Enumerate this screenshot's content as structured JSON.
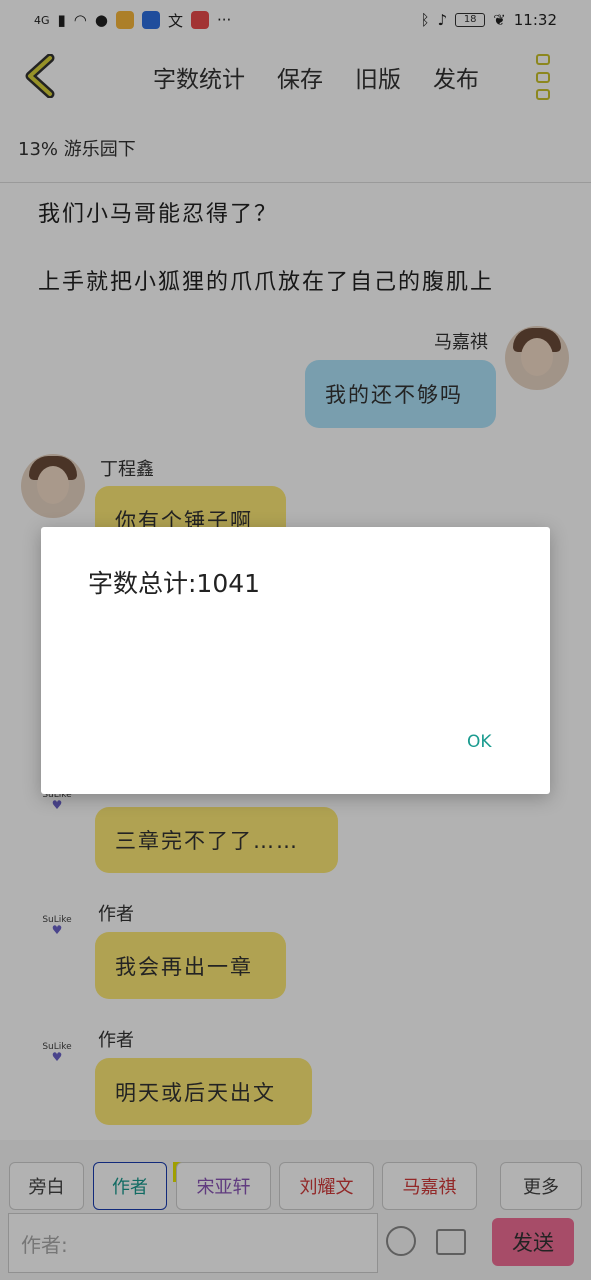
{
  "status_bar": {
    "network": "4G",
    "battery": "18",
    "time": "11:32",
    "icons": [
      "signal-icon",
      "wifi-icon",
      "browser-icon",
      "app-icon",
      "app-icon",
      "translate-icon",
      "app-icon",
      "more-icon",
      "bluetooth-icon",
      "mute-icon",
      "battery-icon",
      "leaf-icon"
    ]
  },
  "toolbar": {
    "word_count_label": "字数统计",
    "save_label": "保存",
    "old_version_label": "旧版",
    "publish_label": "发布"
  },
  "story_header": {
    "progress": "13% 游乐园下"
  },
  "content": {
    "line1": "我们小马哥能忍得了？",
    "line2": "上手就把小狐狸的爪爪放在了自己的腹肌上",
    "msg1_speaker": "马嘉祺",
    "msg1_text": "我的还不够吗",
    "msg2_speaker": "丁程鑫",
    "msg2_text": "你有个锤子啊",
    "msg3_text": "三章完不了了……",
    "msg4_speaker": "作者",
    "msg4_text": "我会再出一章",
    "msg5_speaker": "作者",
    "msg5_text": "明天或后天出文",
    "author_logo": "SuLike"
  },
  "roles": {
    "narration": "旁白",
    "author": "作者",
    "main_tag": "主",
    "song": "宋亚轩",
    "liu": "刘耀文",
    "ma": "马嘉祺",
    "more": "更多"
  },
  "input": {
    "placeholder": "作者:",
    "send_label": "发送"
  },
  "dialog": {
    "message": "字数总计:1041",
    "ok_label": "OK"
  },
  "colors": {
    "blue_bubble": "#aee3fa",
    "yellow_bubble": "#fde876",
    "send_button": "#ef6d96",
    "ok_text": "#1a9b8f"
  }
}
